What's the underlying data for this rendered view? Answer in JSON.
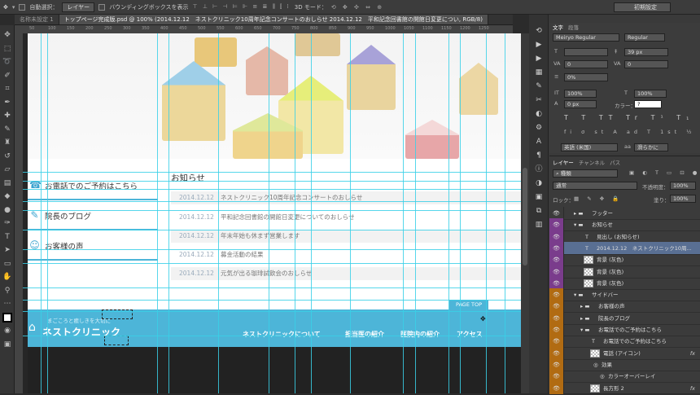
{
  "options_bar": {
    "auto_select_label": "自動選択：",
    "auto_select_value": "レイヤー",
    "bbox_label": "バウンディングボックスを表示",
    "mode3d_label": "3D モード：",
    "preset": "初期設定"
  },
  "tabs": [
    {
      "label": "名称未設定 1",
      "active": false
    },
    {
      "label": "トップページ完成版.psd @ 100% (2014.12.12　ネストクリニック10周年記念コンサートのおしらせ 2014.12.12　平和記念回書館の開館日変更につい, RGB/8)",
      "active": true
    }
  ],
  "ruler_ticks": [
    "50",
    "100",
    "150",
    "200",
    "250",
    "300",
    "350",
    "400",
    "450",
    "500",
    "550",
    "600",
    "650",
    "700",
    "750",
    "800",
    "850",
    "900",
    "950",
    "1000",
    "1050",
    "1100",
    "1150",
    "1200",
    "1250"
  ],
  "document": {
    "sidebar": [
      {
        "icon": "phone-icon",
        "glyph": "☎",
        "label": "お電話でのご予約はこちら"
      },
      {
        "icon": "pencil-icon",
        "glyph": "✎",
        "label": "院長のブログ"
      },
      {
        "icon": "smile-icon",
        "glyph": "☺",
        "label": "お客様の声"
      }
    ],
    "news_title": "お知らせ",
    "news": [
      {
        "date": "2014.12.12",
        "text": "ネストクリニック10周年記念コンサートのおしらせ"
      },
      {
        "date": "2014.12.12",
        "text": "平和記念回書館の開館日変更についてのおしらせ"
      },
      {
        "date": "2014.12.12",
        "text": "年末年始も休まず営業します"
      },
      {
        "date": "2014.12.12",
        "text": "募金活動の結果"
      },
      {
        "date": "2014.12.12",
        "text": "元気が出る珈琲試飲会のおしらせ"
      }
    ],
    "page_top": "PAGE TOP",
    "footer": {
      "tagline": "まごころと癒しきを大切に",
      "logo": "ネストクリニック",
      "nav": [
        "ネストクリニックについて",
        "担当医の紹介",
        "医院内の紹介",
        "アクセス"
      ]
    }
  },
  "char_panel": {
    "tabs": [
      "文字",
      "段落"
    ],
    "font_family": "Meiryo Regular",
    "font_style": "Regular",
    "font_size": "",
    "leading": "39 px",
    "kerning": "0",
    "tracking": "0",
    "tsume": "0%",
    "vscale": "100%",
    "hscale": "100%",
    "baseline": "0 px",
    "color_label": "カラー：",
    "color_value": "?",
    "style_buttons": "T T TT Tr T¹ T₁ T T",
    "lang": "英語 (米国)",
    "aa": "滑らかに"
  },
  "layer_panel": {
    "tabs": [
      "レイヤー",
      "チャンネル",
      "パス"
    ],
    "filter": "種類",
    "blend": "通常",
    "opacity_label": "不透明度：",
    "opacity": "100%",
    "lock_label": "ロック：",
    "fill_label": "塗り：",
    "fill": "100%",
    "layers": [
      {
        "name": "フッター",
        "indent": 1,
        "type": "folder",
        "color": ""
      },
      {
        "name": "お知らせ",
        "indent": 1,
        "type": "folder-open",
        "color": "purple"
      },
      {
        "name": "見出し (お知らせ)",
        "indent": 2,
        "type": "text",
        "color": "purple"
      },
      {
        "name": "2014.12.12　ネストクリニック10周...",
        "indent": 2,
        "type": "text",
        "color": "purple",
        "selected": true
      },
      {
        "name": "背景 (灰色)",
        "indent": 2,
        "type": "shape",
        "color": "purple"
      },
      {
        "name": "背景 (灰色)",
        "indent": 2,
        "type": "shape",
        "color": "purple"
      },
      {
        "name": "背景 (灰色)",
        "indent": 2,
        "type": "shape",
        "color": "purple"
      },
      {
        "name": "サイドバー",
        "indent": 1,
        "type": "folder-open",
        "color": "orange"
      },
      {
        "name": "お客様の声",
        "indent": 2,
        "type": "folder",
        "color": "orange"
      },
      {
        "name": "院長のブログ",
        "indent": 2,
        "type": "folder",
        "color": "orange"
      },
      {
        "name": "お電話でのご予約はこちら",
        "indent": 2,
        "type": "folder-open",
        "color": "orange"
      },
      {
        "name": "お電話でのご予約はこちら",
        "indent": 3,
        "type": "text",
        "color": "orange"
      },
      {
        "name": "電話 (アイコン)",
        "indent": 3,
        "type": "shape",
        "color": "orange",
        "fx": true
      },
      {
        "name": "効果",
        "indent": 4,
        "type": "effect",
        "color": "orange"
      },
      {
        "name": "カラーオーバーレイ",
        "indent": 5,
        "type": "effect",
        "color": "orange"
      },
      {
        "name": "長方形 2",
        "indent": 3,
        "type": "shape",
        "color": "orange",
        "fx": true
      }
    ]
  },
  "colors": {
    "accent": "#4db5d8",
    "guide": "#39d0e8",
    "selected_layer": "#596f93"
  }
}
